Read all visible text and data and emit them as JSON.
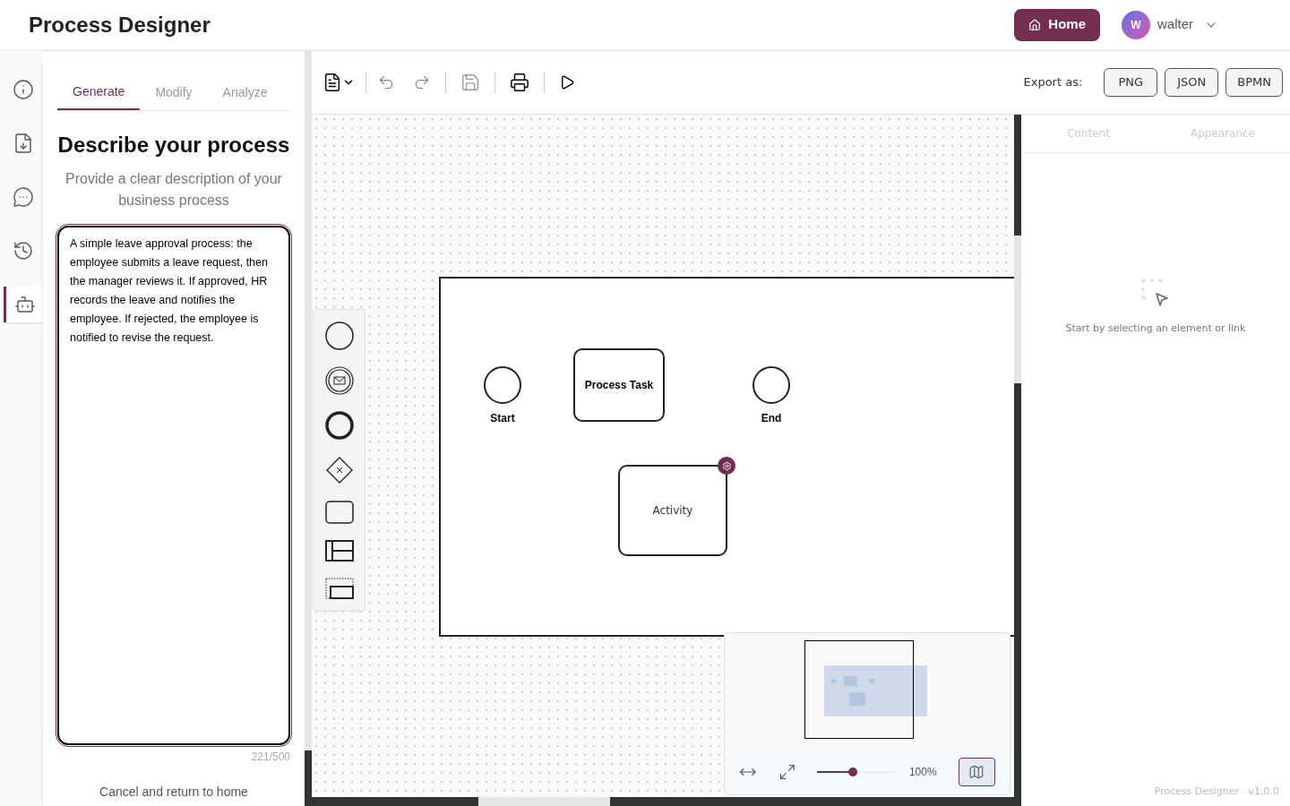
{
  "header": {
    "title": "Process Designer",
    "home_button": "Home",
    "user": {
      "initial": "W",
      "name": "walter"
    }
  },
  "rail": [
    {
      "kind": "info",
      "selected": false
    },
    {
      "kind": "import",
      "selected": false
    },
    {
      "kind": "chat",
      "selected": false
    },
    {
      "kind": "history",
      "selected": false
    },
    {
      "kind": "assistant",
      "selected": true
    }
  ],
  "panel": {
    "tabs": [
      {
        "label": "Generate",
        "selected": true
      },
      {
        "label": "Modify",
        "selected": false
      },
      {
        "label": "Analyze",
        "selected": false
      }
    ],
    "heading": "Describe your process",
    "subtitle": "Provide a clear description of your business process",
    "description": "A simple leave approval process: the employee submits a leave request, then the manager reviews it. If approved, HR records the leave and notifies the employee. If rejected, the employee is notified to revise the request.",
    "counter": "221/500",
    "cancel_link": "Cancel and return to home"
  },
  "toolbar": {
    "export_label": "Export as:",
    "export_buttons": [
      "PNG",
      "JSON",
      "BPMN"
    ]
  },
  "canvas": {
    "nodes": [
      {
        "kind": "start",
        "label": "Start"
      },
      {
        "kind": "task",
        "label": "Process Task"
      },
      {
        "kind": "end",
        "label": "End"
      },
      {
        "kind": "activity",
        "label": "Activity"
      }
    ],
    "zoom": {
      "level": 0.45,
      "reading": "100%",
      "minimap_on": true
    }
  },
  "properties": {
    "tabs": [
      {
        "label": "Content",
        "disabled": true
      },
      {
        "label": "Appearance",
        "disabled": true
      }
    ],
    "empty_hint": "Start by selecting an element or link"
  },
  "footer": "Process Designer · v1.0.0"
}
